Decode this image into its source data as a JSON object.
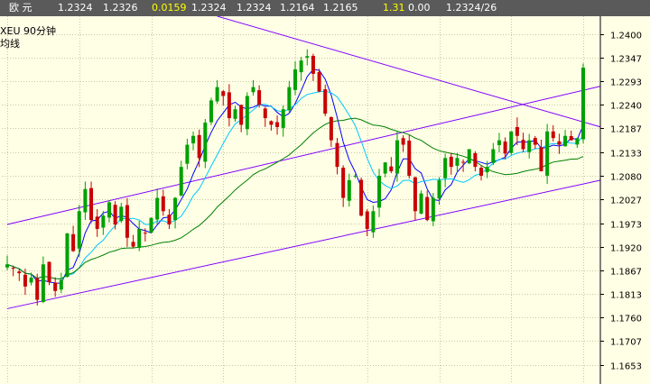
{
  "header": {
    "name": "欧  元",
    "last": "1.2324",
    "ask": "1.2326",
    "change": "0.0159",
    "open": "1.2324",
    "high": "1.2324",
    "low": "1.2164",
    "prev": "1.2165",
    "change_pct": "1.31",
    "volume": "0.00",
    "cursor": "1.2324/26"
  },
  "overlay": {
    "symbol_period": "XEU    90分钟",
    "indicator": "均线"
  },
  "colors": {
    "background": "#FFFFE6",
    "grid": "#C8C8A0",
    "up_candle": "#00A000",
    "down_candle": "#C80000",
    "ma_fast": "#0000FF",
    "ma_mid": "#00C8FF",
    "ma_slow": "#008000",
    "trendline": "#8000FF"
  },
  "chart_data": {
    "type": "candlestick",
    "symbol": "XEU",
    "period": "90分钟",
    "y_ticks": [
      "1.2400",
      "1.2347",
      "1.2293",
      "1.2240",
      "1.2187",
      "1.2133",
      "1.2080",
      "1.2027",
      "1.1973",
      "1.1920",
      "1.1867",
      "1.1813",
      "1.1760",
      "1.1707",
      "1.1653"
    ],
    "ylim": [
      1.161,
      1.244
    ],
    "grid": true,
    "close_series": [
      1.188,
      1.187,
      1.186,
      1.183,
      1.185,
      1.18,
      1.188,
      1.184,
      1.182,
      1.1845,
      1.195,
      1.191,
      1.2,
      1.205,
      1.198,
      1.196,
      1.199,
      1.202,
      1.197,
      1.201,
      1.194,
      1.192,
      1.196,
      1.195,
      1.1985,
      1.203,
      1.2,
      1.197,
      1.203,
      1.21,
      1.215,
      1.217,
      1.212,
      1.22,
      1.225,
      1.228,
      1.226,
      1.221,
      1.223,
      1.2195,
      1.226,
      1.228,
      1.224,
      1.221,
      1.2195,
      1.219,
      1.223,
      1.228,
      1.232,
      1.234,
      1.235,
      1.231,
      1.227,
      1.222,
      1.216,
      1.21,
      1.203,
      1.207,
      1.208,
      1.199,
      1.196,
      1.2,
      1.208,
      1.211,
      1.209,
      1.216,
      1.215,
      1.208,
      1.2,
      1.204,
      1.198,
      1.203,
      1.207,
      1.212,
      1.21,
      1.212,
      1.211,
      1.214,
      1.21,
      1.208,
      1.21,
      1.214,
      1.216,
      1.213,
      1.218,
      1.217,
      1.214,
      1.216,
      1.215,
      1.209,
      1.218,
      1.2165,
      1.215,
      1.217,
      1.216,
      1.2165,
      1.2324
    ],
    "trendlines": [
      {
        "name": "upper-channel",
        "from": [
          0,
          1.197
        ],
        "to": [
          95,
          1.2282
        ]
      },
      {
        "name": "lower-channel",
        "from": [
          0,
          1.178
        ],
        "to": [
          95,
          1.207
        ]
      },
      {
        "name": "resistance",
        "from": [
          35,
          1.244
        ],
        "to": [
          95,
          1.219
        ]
      }
    ],
    "moving_averages": [
      {
        "color_key": "ma_fast",
        "period": 5
      },
      {
        "color_key": "ma_mid",
        "period": 10
      },
      {
        "color_key": "ma_slow",
        "period": 30
      }
    ]
  }
}
